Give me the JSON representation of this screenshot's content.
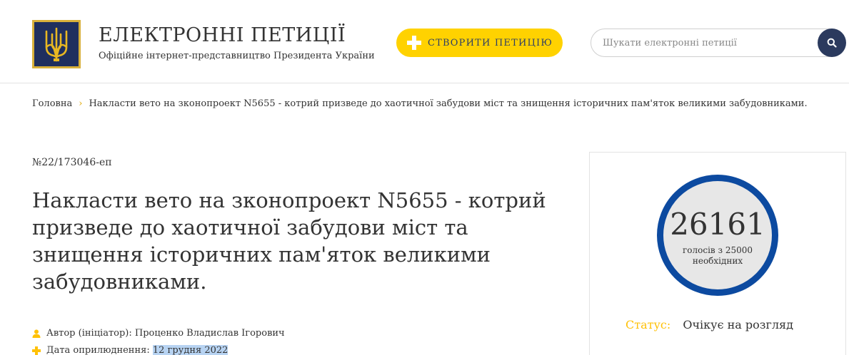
{
  "header": {
    "site_title": "ЕЛЕКТРОННІ ПЕТИЦІЇ",
    "site_subtitle": "Офіційне інтернет-представництво Президента України",
    "create_button_label": "СТВОРИТИ ПЕТИЦІЮ",
    "search_placeholder": "Шукати електронні петиції",
    "search_value": ""
  },
  "breadcrumb": {
    "home": "Головна",
    "current": "Накласти вето на зконопроект N5655 - котрий призведе до хаотичної забудови міст та знищення історичних пам'яток великими забудовниками."
  },
  "petition": {
    "number": "№22/173046-еп",
    "title": "Накласти вето на зконопроект N5655 - котрий призведе до хаотичної забудови міст та знищення історичних пам'яток великими забудовниками.",
    "author_label": "Автор (ініціатор):",
    "author_name": "Проценко Владислав Ігорович",
    "date_label": "Дата оприлюднення:",
    "date_value": "12 грудня 2022"
  },
  "sidebar": {
    "votes_count": "26161",
    "votes_caption": "голосів з 25000 необхідних",
    "status_label": "Статус:",
    "status_value": "Очікує на розгляд"
  },
  "colors": {
    "accent_yellow": "#ffd200",
    "navy": "#2b3a5e",
    "counter_ring": "#0c4aa0",
    "status_label": "#ffc107",
    "breadcrumb_separator": "#e0a800"
  },
  "icons": {
    "logo": "trident-emblem",
    "create": "plus-icon",
    "search": "search-icon",
    "breadcrumb_sep": "chevron-right-icon",
    "author": "user-icon",
    "date": "plus-icon"
  }
}
